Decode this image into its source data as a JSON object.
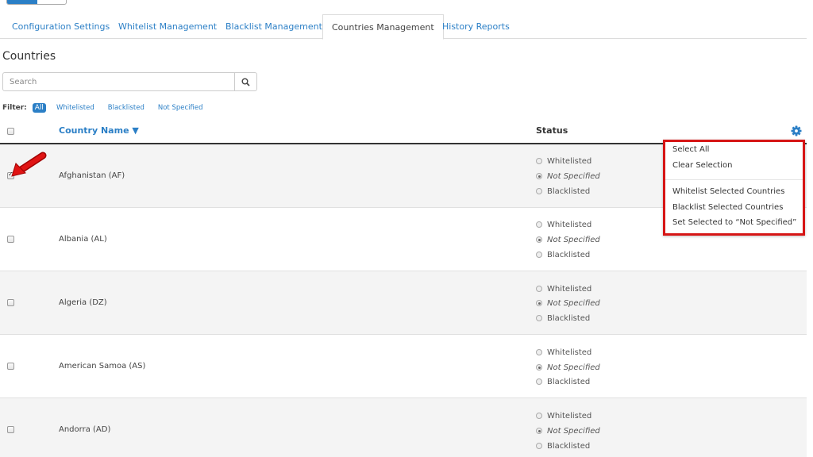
{
  "tabs": [
    {
      "label": "Configuration Settings"
    },
    {
      "label": "Whitelist Management"
    },
    {
      "label": "Blacklist Management"
    },
    {
      "label": "Countries Management"
    },
    {
      "label": "History Reports"
    }
  ],
  "active_tab": "Countries Management",
  "section_title": "Countries",
  "search": {
    "placeholder": "Search",
    "icon": "search-icon"
  },
  "filter": {
    "label": "Filter:",
    "options": [
      "All",
      "Whitelisted",
      "Blacklisted",
      "Not Specified"
    ],
    "selected": "All"
  },
  "table": {
    "columns": {
      "country": "Country Name ▼",
      "status": "Status"
    },
    "settings_icon": "gear-icon",
    "status_options": [
      "Whitelisted",
      "Not Specified",
      "Blacklisted"
    ],
    "rows": [
      {
        "country": "Afghanistan (AF)",
        "checked": true,
        "status": "Not Specified"
      },
      {
        "country": "Albania (AL)",
        "checked": false,
        "status": "Not Specified"
      },
      {
        "country": "Algeria (DZ)",
        "checked": false,
        "status": "Not Specified"
      },
      {
        "country": "American Samoa (AS)",
        "checked": false,
        "status": "Not Specified"
      },
      {
        "country": "Andorra (AD)",
        "checked": false,
        "status": "Not Specified"
      }
    ]
  },
  "dropdown": {
    "items": [
      "Select All",
      "Clear Selection",
      "Whitelist Selected Countries",
      "Blacklist Selected Countries",
      "Set Selected to “Not Specified”"
    ]
  },
  "colors": {
    "accent": "#2b7fc6",
    "highlight": "#d61515"
  }
}
